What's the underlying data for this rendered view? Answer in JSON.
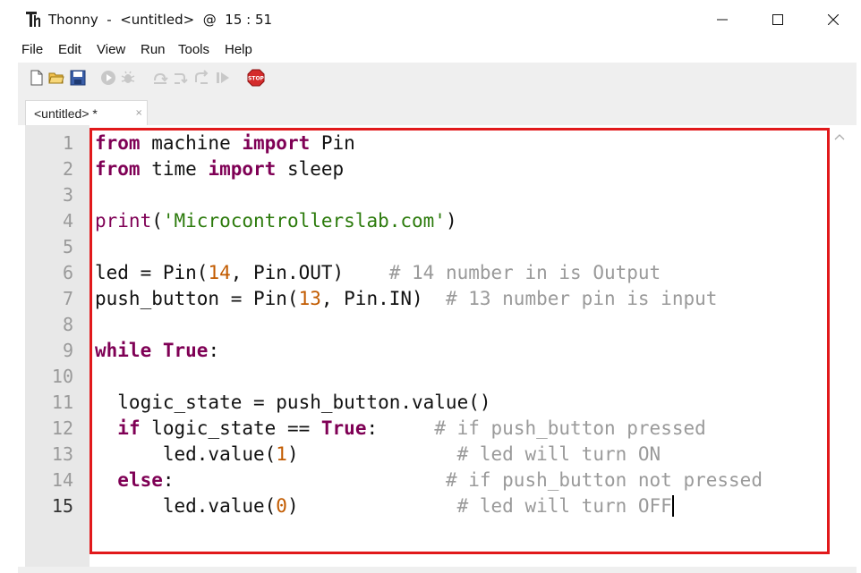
{
  "window": {
    "title": "Thonny  -  <untitled>  @  15 : 51",
    "controls": {
      "minimize": "—",
      "maximize": "☐",
      "close": "✕"
    }
  },
  "menu": {
    "items": [
      "File",
      "Edit",
      "View",
      "Run",
      "Tools",
      "Help"
    ]
  },
  "toolbar": {
    "icons": [
      "new-file-icon",
      "open-folder-icon",
      "save-icon",
      "run-icon",
      "debug-icon",
      "step-over-icon",
      "step-into-icon",
      "step-out-icon",
      "resume-icon",
      "stop-icon"
    ],
    "stop_label": "STOP"
  },
  "tabs": [
    {
      "label": "<untitled> *",
      "close": "×"
    }
  ],
  "editor": {
    "current_line": 15,
    "line_numbers": [
      "1",
      "2",
      "3",
      "4",
      "5",
      "6",
      "7",
      "8",
      "9",
      "10",
      "11",
      "12",
      "13",
      "14",
      "15"
    ],
    "lines": [
      [
        [
          "kw",
          "from"
        ],
        [
          "",
          " machine "
        ],
        [
          "kw",
          "import"
        ],
        [
          "",
          " Pin"
        ]
      ],
      [
        [
          "kw",
          "from"
        ],
        [
          "",
          " time "
        ],
        [
          "kw",
          "import"
        ],
        [
          "",
          " sleep"
        ]
      ],
      [],
      [
        [
          "bi",
          "print"
        ],
        [
          "",
          "("
        ],
        [
          "str",
          "'Microcontrollerslab.com'"
        ],
        [
          "",
          ")"
        ]
      ],
      [],
      [
        [
          "",
          "led = Pin("
        ],
        [
          "num",
          "14"
        ],
        [
          "",
          ", Pin.OUT)    "
        ],
        [
          "cm",
          "# 14 number in is Output"
        ]
      ],
      [
        [
          "",
          "push_button = Pin("
        ],
        [
          "num",
          "13"
        ],
        [
          "",
          ", Pin.IN)  "
        ],
        [
          "cm",
          "# 13 number pin is input"
        ]
      ],
      [],
      [
        [
          "kw",
          "while"
        ],
        [
          "",
          " "
        ],
        [
          "kw",
          "True"
        ],
        [
          "",
          ":"
        ]
      ],
      [],
      [
        [
          "",
          "  logic_state = push_button.value()"
        ]
      ],
      [
        [
          "",
          "  "
        ],
        [
          "kw",
          "if"
        ],
        [
          "",
          " logic_state == "
        ],
        [
          "kw",
          "True"
        ],
        [
          "",
          ":     "
        ],
        [
          "cm",
          "# if push_button pressed"
        ]
      ],
      [
        [
          "",
          "      led.value("
        ],
        [
          "num",
          "1"
        ],
        [
          "",
          ")              "
        ],
        [
          "cm",
          "# led will turn ON"
        ]
      ],
      [
        [
          "",
          "  "
        ],
        [
          "kw",
          "else"
        ],
        [
          "",
          ":                        "
        ],
        [
          "cm",
          "# if push_button not pressed"
        ]
      ],
      [
        [
          "",
          "      led.value("
        ],
        [
          "num",
          "0"
        ],
        [
          "",
          ")              "
        ],
        [
          "cm",
          "# led will turn OFF"
        ]
      ]
    ]
  },
  "colors": {
    "highlight_frame": "#e1191b",
    "keyword": "#7f0055",
    "string": "#2b7a0b",
    "number": "#c25b00",
    "comment": "#9a9a9a",
    "gutter": "#e8e8e8",
    "chrome": "#efefef"
  }
}
